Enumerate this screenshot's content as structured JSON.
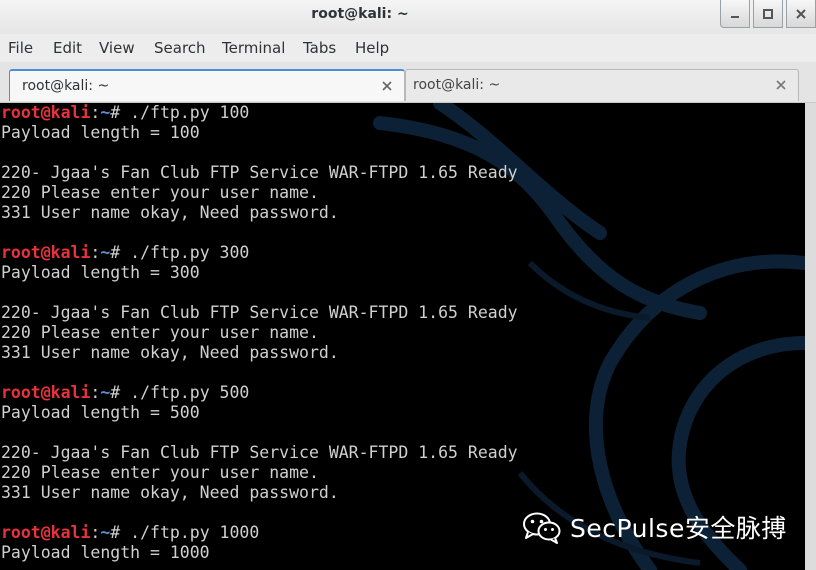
{
  "window": {
    "title": "root@kali: ~"
  },
  "menu": {
    "items": [
      "File",
      "Edit",
      "View",
      "Search",
      "Terminal",
      "Tabs",
      "Help"
    ]
  },
  "tabs": [
    {
      "label": "root@kali: ~",
      "active": true
    },
    {
      "label": "root@kali: ~",
      "active": false
    }
  ],
  "terminal": {
    "prompt": {
      "user_host": "root@kali",
      "colon": ":",
      "path": "~",
      "symbol": "#"
    },
    "lines": [
      {
        "type": "prompt",
        "command": " ./ftp.py 100"
      },
      {
        "type": "output",
        "text": "Payload length = 100"
      },
      {
        "type": "output",
        "text": ""
      },
      {
        "type": "output",
        "text": "220- Jgaa's Fan Club FTP Service WAR-FTPD 1.65 Ready"
      },
      {
        "type": "output",
        "text": "220 Please enter your user name."
      },
      {
        "type": "output",
        "text": "331 User name okay, Need password."
      },
      {
        "type": "output",
        "text": ""
      },
      {
        "type": "prompt",
        "command": " ./ftp.py 300"
      },
      {
        "type": "output",
        "text": "Payload length = 300"
      },
      {
        "type": "output",
        "text": ""
      },
      {
        "type": "output",
        "text": "220- Jgaa's Fan Club FTP Service WAR-FTPD 1.65 Ready"
      },
      {
        "type": "output",
        "text": "220 Please enter your user name."
      },
      {
        "type": "output",
        "text": "331 User name okay, Need password."
      },
      {
        "type": "output",
        "text": ""
      },
      {
        "type": "prompt",
        "command": " ./ftp.py 500"
      },
      {
        "type": "output",
        "text": "Payload length = 500"
      },
      {
        "type": "output",
        "text": ""
      },
      {
        "type": "output",
        "text": "220- Jgaa's Fan Club FTP Service WAR-FTPD 1.65 Ready"
      },
      {
        "type": "output",
        "text": "220 Please enter your user name."
      },
      {
        "type": "output",
        "text": "331 User name okay, Need password."
      },
      {
        "type": "output",
        "text": ""
      },
      {
        "type": "prompt",
        "command": " ./ftp.py 1000"
      },
      {
        "type": "output",
        "text": "Payload length = 1000"
      }
    ]
  },
  "watermark": {
    "text": "SecPulse安全脉搏",
    "icon": "wechat-icon"
  },
  "colors": {
    "terminal_bg": "#000000",
    "terminal_fg": "#d0d0d0",
    "prompt_user": "#e8323c",
    "prompt_path": "#5c8fd6",
    "tab_accent": "#4a90d9"
  }
}
